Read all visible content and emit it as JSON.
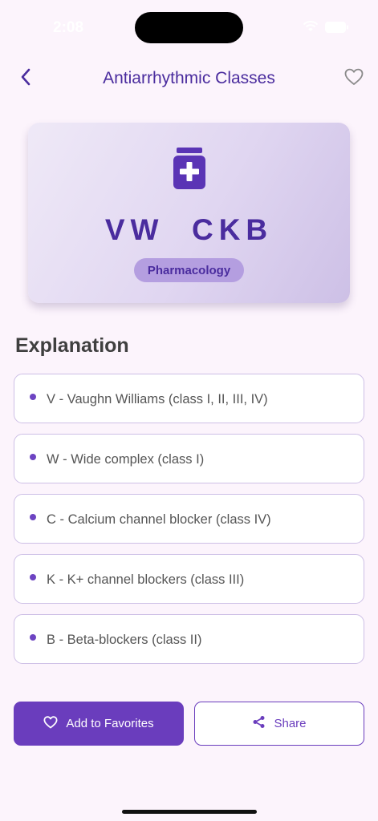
{
  "status_bar": {
    "time": "2:08"
  },
  "header": {
    "title": "Antiarrhythmic Classes",
    "back_icon": "chevron-left-icon",
    "favorite_icon": "heart-outline-icon"
  },
  "card": {
    "icon": "medicine-bottle-icon",
    "mnemonic": "VW  CKB",
    "category": "Pharmacology"
  },
  "explanation": {
    "heading": "Explanation",
    "items": [
      {
        "text": "V - Vaughn Williams (class I, II, III, IV)"
      },
      {
        "text": "W - Wide complex (class I)"
      },
      {
        "text": "C - Calcium channel blocker (class IV)"
      },
      {
        "text": "K - K+ channel blockers (class III)"
      },
      {
        "text": "B - Beta-blockers (class II)"
      }
    ]
  },
  "actions": {
    "add_favorites_label": "Add to Favorites",
    "share_label": "Share"
  },
  "colors": {
    "accent": "#6a3dbd",
    "title": "#4a2c9e",
    "background": "#fcf4fc",
    "badge": "#b49ee0"
  }
}
